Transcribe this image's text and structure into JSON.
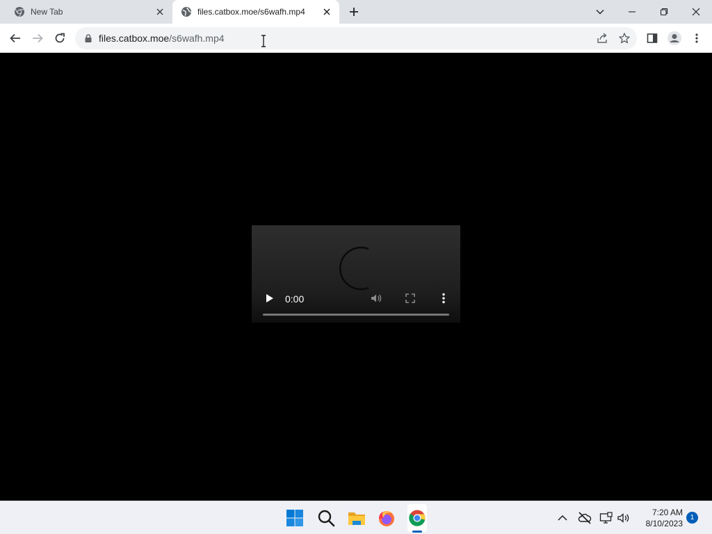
{
  "browser": {
    "tabs": [
      {
        "title": "New Tab",
        "active": false,
        "icon": "chrome-icon"
      },
      {
        "title": "files.catbox.moe/s6wafh.mp4",
        "active": true,
        "icon": "globe-icon"
      }
    ],
    "omnibox": {
      "host": "files.catbox.moe",
      "path": "/s6wafh.mp4"
    }
  },
  "video": {
    "current_time": "0:00",
    "progress_fraction": 0.0
  },
  "taskbar": {
    "apps": [
      "windows-start-icon",
      "search-icon",
      "file-explorer-icon",
      "firefox-icon",
      "chrome-icon"
    ],
    "clock": {
      "time": "7:20 AM",
      "date": "8/10/2023"
    },
    "notification_count": "1"
  },
  "colors": {
    "tabstrip": "#dee1e6",
    "omnibox": "#f1f3f4",
    "taskbar": "#eef0f5",
    "accent": "#005fb8"
  }
}
